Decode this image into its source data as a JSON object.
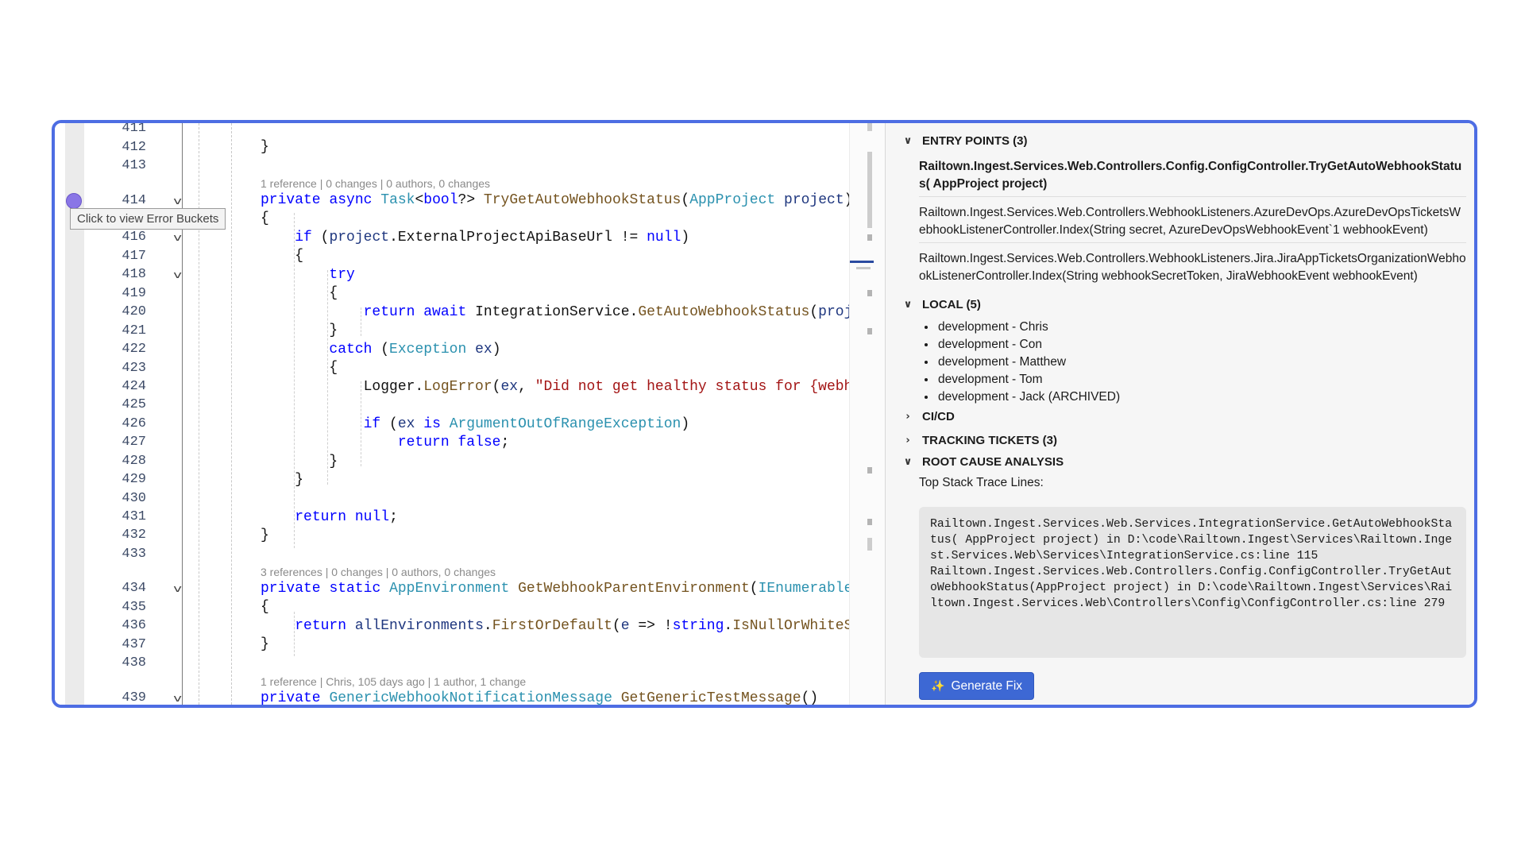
{
  "editor": {
    "line_numbers": [
      "411",
      "412",
      "413",
      "414",
      "416",
      "417",
      "418",
      "419",
      "420",
      "421",
      "422",
      "423",
      "424",
      "425",
      "426",
      "427",
      "428",
      "429",
      "430",
      "431",
      "432",
      "433",
      "434",
      "435",
      "436",
      "437",
      "438",
      "439"
    ],
    "code_lens": [
      "1 reference | 0 changes | 0 authors, 0 changes",
      "3 references | 0 changes | 0 authors, 0 changes",
      "1 reference | Chris, 105 days ago | 1 author, 1 change"
    ],
    "tooltip": "Click to view Error Buckets"
  },
  "panel": {
    "entry_points": {
      "title": "ENTRY POINTS (3)",
      "items": [
        "Railtown.Ingest.Services.Web.Controllers.Config.ConfigController.TryGetAutoWebhookStatus( AppProject project)",
        "Railtown.Ingest.Services.Web.Controllers.WebhookListeners.AzureDevOps.AzureDevOpsTicketsWebhookListenerController.Index(String secret, AzureDevOpsWebhookEvent`1 webhookEvent)",
        "Railtown.Ingest.Services.Web.Controllers.WebhookListeners.Jira.JiraAppTicketsOrganizationWebhookListenerController.Index(String webhookSecretToken, JiraWebhookEvent webhookEvent)"
      ]
    },
    "local": {
      "title": "LOCAL (5)",
      "items": [
        "development - Chris",
        "development - Con",
        "development - Matthew",
        "development - Tom",
        "development - Jack (ARCHIVED)"
      ]
    },
    "cicd": {
      "title": "CI/CD"
    },
    "tracking": {
      "title": "TRACKING TICKETS (3)"
    },
    "rca": {
      "title": "ROOT CAUSE ANALYSIS",
      "label": "Top Stack Trace Lines:",
      "stack": "Railtown.Ingest.Services.Web.Services.IntegrationService.GetAutoWebhookStatus( AppProject project) in D:\\code\\Railtown.Ingest\\Services\\Railtown.Ingest.Services.Web\\Services\\IntegrationService.cs:line 115\nRailtown.Ingest.Services.Web.Controllers.Config.ConfigController.TryGetAutoWebhookStatus(AppProject project) in D:\\code\\Railtown.Ingest\\Services\\Railtown.Ingest.Services.Web\\Controllers\\Config\\ConfigController.cs:line 279",
      "button": "Generate Fix"
    }
  }
}
